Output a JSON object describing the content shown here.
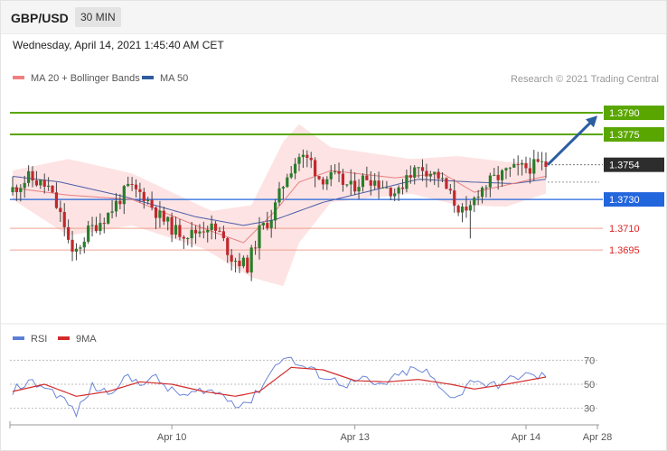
{
  "header": {
    "symbol": "GBP/USD",
    "timeframe": "30 MIN",
    "datetime": "Wednesday, April 14, 2021 1:45:40 AM CET"
  },
  "chart_data": [
    {
      "type": "candlestick",
      "legend": [
        {
          "label": "MA 20 + Bollinger Bands",
          "color": "#f08080"
        },
        {
          "label": "MA 50",
          "color": "#2f5d9f"
        }
      ],
      "credit": "Research © 2021 Trading Central",
      "y_range": [
        1.3652,
        1.3805
      ],
      "levels": [
        {
          "label": "1.3790",
          "value": 1.379,
          "style": "resistance",
          "color": "#5aa600"
        },
        {
          "label": "1.3775",
          "value": 1.3775,
          "style": "resistance",
          "color": "#5aa600"
        },
        {
          "label": "1.3754",
          "value": 1.3754,
          "style": "last",
          "color": "#2d2d2d"
        },
        {
          "label": "1.3730",
          "value": 1.373,
          "style": "pivot",
          "color": "#2266dd"
        },
        {
          "label": "1.3710",
          "value": 1.371,
          "style": "support",
          "color": "#dd2222"
        },
        {
          "label": "1.3695",
          "value": 1.3695,
          "style": "support",
          "color": "#dd2222"
        }
      ],
      "dotted_level": 1.3742,
      "arrow": {
        "from": 1.3754,
        "to": 1.3788,
        "color": "#2b5ea0"
      },
      "anchors": [
        [
          0,
          1.3735
        ],
        [
          5,
          1.3745
        ],
        [
          10,
          1.3738
        ],
        [
          14,
          1.3712
        ],
        [
          16,
          1.369
        ],
        [
          20,
          1.3708
        ],
        [
          25,
          1.372
        ],
        [
          30,
          1.3738
        ],
        [
          34,
          1.3733
        ],
        [
          38,
          1.3718
        ],
        [
          42,
          1.3708
        ],
        [
          46,
          1.3706
        ],
        [
          50,
          1.3712
        ],
        [
          53,
          1.3706
        ],
        [
          56,
          1.369
        ],
        [
          60,
          1.3684
        ],
        [
          63,
          1.3708
        ],
        [
          66,
          1.3718
        ],
        [
          70,
          1.3748
        ],
        [
          73,
          1.376
        ],
        [
          76,
          1.3756
        ],
        [
          78,
          1.3745
        ],
        [
          82,
          1.3745
        ],
        [
          86,
          1.3738
        ],
        [
          90,
          1.3746
        ],
        [
          94,
          1.374
        ],
        [
          98,
          1.3734
        ],
        [
          100,
          1.3748
        ],
        [
          104,
          1.3752
        ],
        [
          108,
          1.3746
        ],
        [
          112,
          1.3728
        ],
        [
          115,
          1.3718
        ],
        [
          118,
          1.3736
        ],
        [
          122,
          1.3744
        ],
        [
          126,
          1.375
        ],
        [
          130,
          1.3752
        ],
        [
          134,
          1.3754
        ]
      ],
      "spike": {
        "index": 115,
        "low": 1.3703
      },
      "ma20": [
        [
          0,
          1.3738
        ],
        [
          14,
          1.3733
        ],
        [
          30,
          1.373
        ],
        [
          46,
          1.3712
        ],
        [
          58,
          1.37
        ],
        [
          66,
          1.3722
        ],
        [
          72,
          1.3742
        ],
        [
          80,
          1.375
        ],
        [
          96,
          1.3745
        ],
        [
          108,
          1.3748
        ],
        [
          116,
          1.3735
        ],
        [
          124,
          1.374
        ],
        [
          134,
          1.3746
        ]
      ],
      "ma50": [
        [
          0,
          1.3746
        ],
        [
          12,
          1.3742
        ],
        [
          28,
          1.3732
        ],
        [
          46,
          1.3718
        ],
        [
          58,
          1.3712
        ],
        [
          66,
          1.3716
        ],
        [
          78,
          1.3728
        ],
        [
          90,
          1.3736
        ],
        [
          102,
          1.3744
        ],
        [
          116,
          1.3742
        ],
        [
          126,
          1.3741
        ],
        [
          134,
          1.3744
        ]
      ],
      "bb_upper": [
        [
          0,
          1.375
        ],
        [
          14,
          1.3758
        ],
        [
          30,
          1.3748
        ],
        [
          50,
          1.3722
        ],
        [
          60,
          1.3726
        ],
        [
          68,
          1.377
        ],
        [
          72,
          1.3782
        ],
        [
          80,
          1.3766
        ],
        [
          100,
          1.3758
        ],
        [
          112,
          1.376
        ],
        [
          124,
          1.3756
        ],
        [
          134,
          1.3755
        ]
      ],
      "bb_lower": [
        [
          0,
          1.373
        ],
        [
          14,
          1.3705
        ],
        [
          30,
          1.3712
        ],
        [
          48,
          1.3696
        ],
        [
          60,
          1.3676
        ],
        [
          68,
          1.367
        ],
        [
          72,
          1.37
        ],
        [
          80,
          1.3728
        ],
        [
          100,
          1.3734
        ],
        [
          112,
          1.3726
        ],
        [
          124,
          1.3725
        ],
        [
          134,
          1.3734
        ]
      ]
    },
    {
      "type": "line",
      "legend": [
        {
          "label": "RSI",
          "color": "#5b7fd6"
        },
        {
          "label": "9MA",
          "color": "#d42b2b"
        }
      ],
      "y_range": [
        20,
        80
      ],
      "y_ticks": [
        {
          "label": "70",
          "value": 70
        },
        {
          "label": "50",
          "value": 50
        },
        {
          "label": "30",
          "value": 30
        }
      ],
      "rsi": [
        [
          0,
          45
        ],
        [
          4,
          52
        ],
        [
          8,
          48
        ],
        [
          12,
          40
        ],
        [
          16,
          26
        ],
        [
          20,
          48
        ],
        [
          24,
          43
        ],
        [
          28,
          55
        ],
        [
          32,
          52
        ],
        [
          36,
          55
        ],
        [
          40,
          44
        ],
        [
          44,
          40
        ],
        [
          48,
          46
        ],
        [
          52,
          42
        ],
        [
          56,
          34
        ],
        [
          60,
          36
        ],
        [
          64,
          56
        ],
        [
          68,
          74
        ],
        [
          72,
          66
        ],
        [
          76,
          60
        ],
        [
          80,
          54
        ],
        [
          84,
          50
        ],
        [
          88,
          54
        ],
        [
          92,
          48
        ],
        [
          96,
          55
        ],
        [
          100,
          62
        ],
        [
          104,
          60
        ],
        [
          108,
          44
        ],
        [
          112,
          40
        ],
        [
          116,
          55
        ],
        [
          120,
          48
        ],
        [
          124,
          52
        ],
        [
          128,
          58
        ],
        [
          132,
          56
        ],
        [
          134,
          58
        ]
      ],
      "rsi9": [
        [
          0,
          44
        ],
        [
          8,
          50
        ],
        [
          16,
          40
        ],
        [
          24,
          44
        ],
        [
          32,
          52
        ],
        [
          40,
          50
        ],
        [
          48,
          44
        ],
        [
          56,
          40
        ],
        [
          62,
          44
        ],
        [
          70,
          64
        ],
        [
          78,
          62
        ],
        [
          86,
          53
        ],
        [
          94,
          52
        ],
        [
          102,
          54
        ],
        [
          110,
          50
        ],
        [
          116,
          46
        ],
        [
          124,
          50
        ],
        [
          134,
          56
        ]
      ],
      "x_ticks": [
        {
          "label": "Apr 10",
          "index": 40
        },
        {
          "label": "Apr 13",
          "index": 86
        },
        {
          "label": "Apr 14",
          "index": 129
        },
        {
          "label": "Apr 28",
          "index": 145
        }
      ]
    }
  ]
}
